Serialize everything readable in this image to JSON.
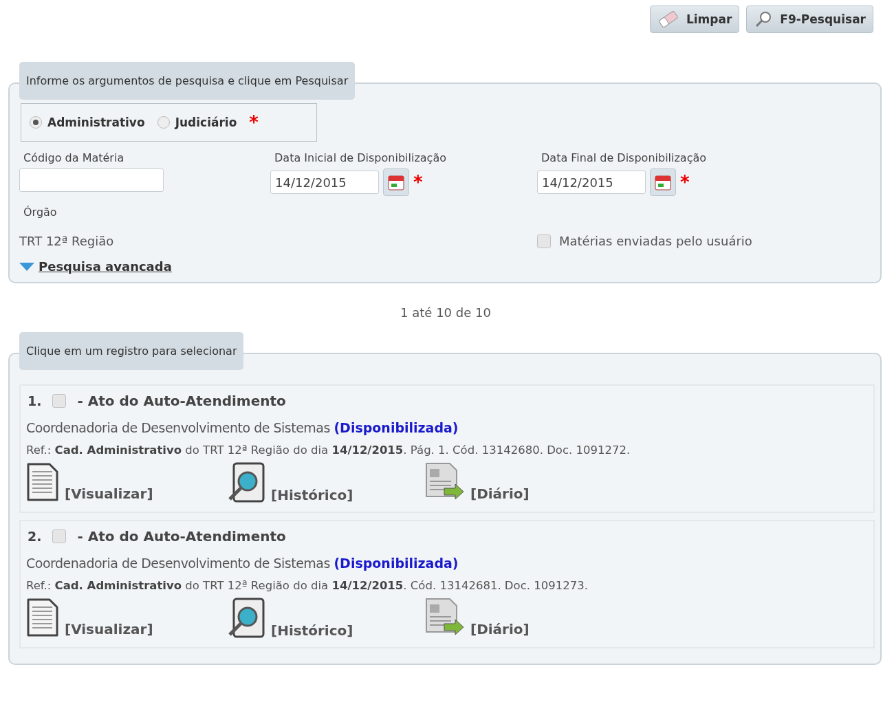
{
  "toolbar": {
    "buttons": [
      {
        "kind": "clear",
        "label": "Limpar"
      },
      {
        "kind": "search",
        "label": "F9-Pesquisar"
      }
    ]
  },
  "search_panel": {
    "legend": "Informe os argumentos de pesquisa e clique em Pesquisar",
    "scope": [
      {
        "label": "Administrativo",
        "selected": true
      },
      {
        "label": "Judiciário",
        "selected": false
      }
    ],
    "required_mark": "*",
    "fields": [
      {
        "label": "Código da Matéria",
        "kind": "text"
      },
      {
        "label": "Data Inicial de Disponibilização",
        "kind": "date",
        "value": "14/12/2015",
        "required_mark": "*"
      },
      {
        "label": "Data Final de Disponibilização",
        "kind": "date",
        "value": "14/12/2015",
        "required_mark": "*"
      }
    ],
    "organ_label": "Órgão",
    "organ_value": "TRT 12ª Região",
    "user_checkbox": {
      "label": "Matérias enviadas pelo usuário",
      "checked": false
    },
    "advanced_link": "Pesquisa avancada"
  },
  "pager": "1 até 10 de 10",
  "results": {
    "legend": "Clique em um registro para selecionar",
    "records": [
      {
        "number": "1.",
        "checked": false,
        "title": "- Ato do Auto-Atendimento",
        "unit": "Coordenadoria de Desenvolvimento de Sistemas",
        "status": "(Disponibilizada)",
        "ref": "Ref.: **Cad. Administrativo** do TRT 12ª Região do dia **14/12/2015**. Pág. 1. Cód. 13142680. Doc. 1091272.",
        "actions": [
          {
            "kind": "view",
            "label": "[Visualizar]"
          },
          {
            "kind": "history",
            "label": "[Histórico]"
          },
          {
            "kind": "journal",
            "label": "[Diário]"
          }
        ]
      },
      {
        "number": "2.",
        "checked": false,
        "title": "- Ato do Auto-Atendimento",
        "unit": "Coordenadoria de Desenvolvimento de Sistemas",
        "status": "(Disponibilizada)",
        "ref": "Ref.: **Cad. Administrativo** do TRT 12ª Região do dia **14/12/2015**. Cód. 13142681. Doc. 1091273.",
        "actions": [
          {
            "kind": "view",
            "label": "[Visualizar]"
          },
          {
            "kind": "history",
            "label": "[Histórico]"
          },
          {
            "kind": "journal",
            "label": "[Diário]"
          }
        ]
      }
    ]
  }
}
